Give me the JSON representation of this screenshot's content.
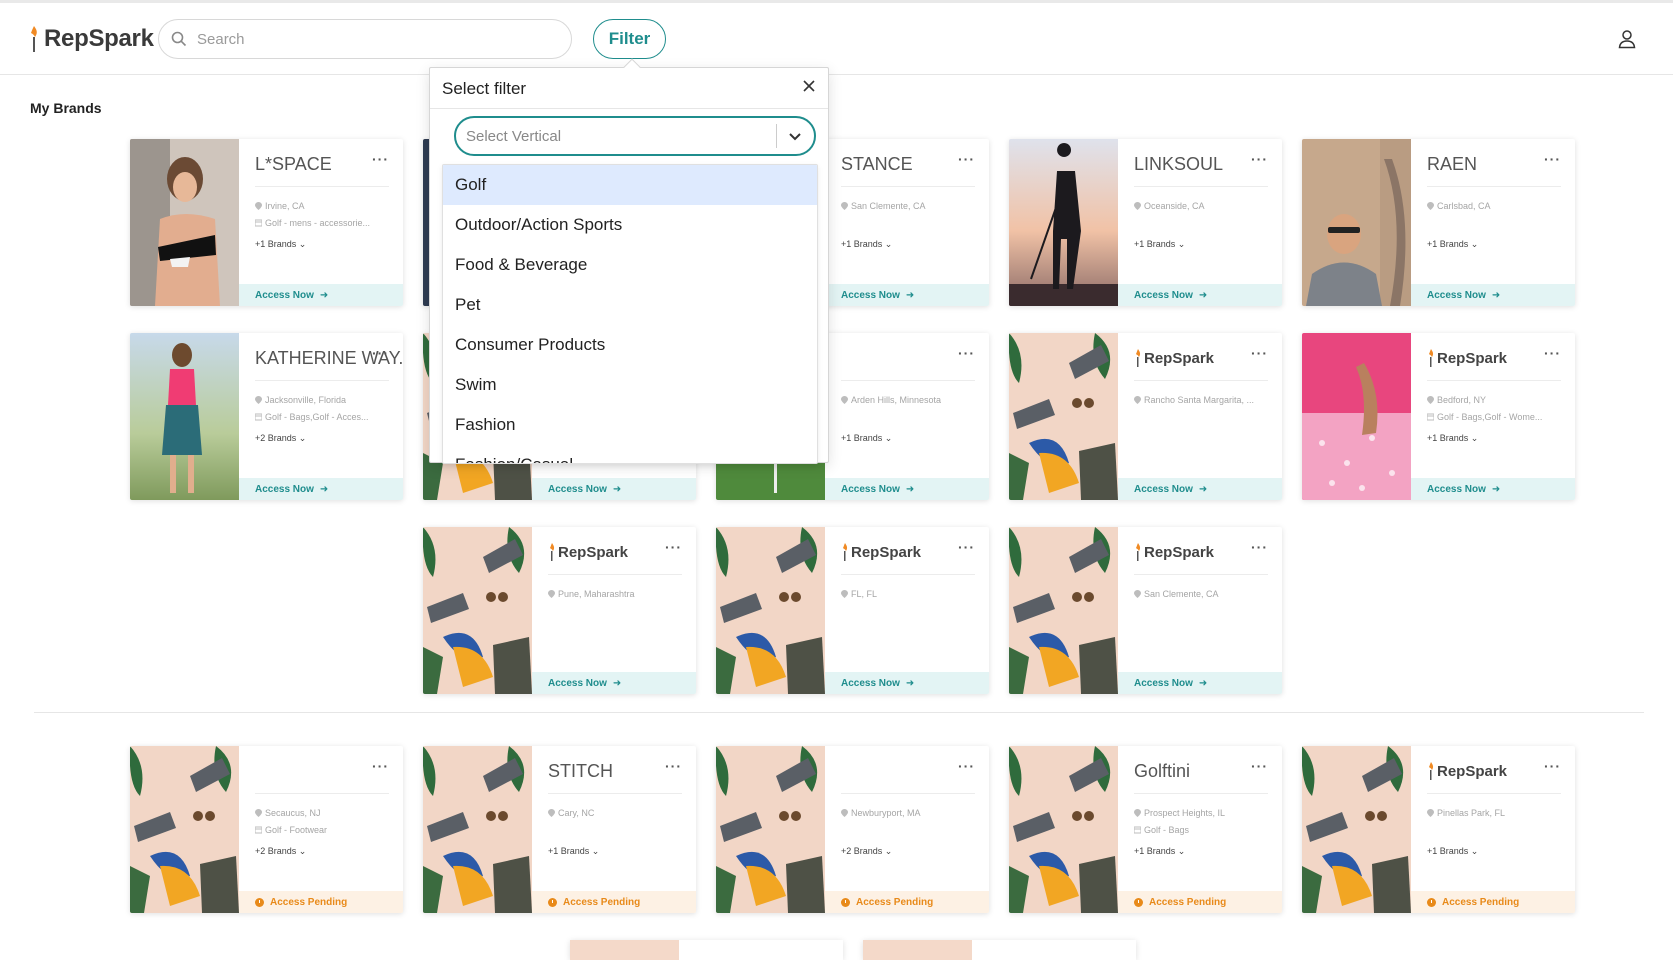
{
  "header": {
    "logo_text": "RepSpark",
    "search_placeholder": "Search",
    "filter_label": "Filter"
  },
  "section_title": "My Brands",
  "cards": [
    {
      "logo": "L*SPACE",
      "location": "Irvine, CA",
      "category": "Golf - mens - accessorie...",
      "brands": "+1 Brands",
      "status": "Access Now"
    },
    {
      "logo": "",
      "location": "",
      "category": "",
      "brands": "",
      "status": ""
    },
    {
      "logo": "STANCE",
      "location": "San Clemente, CA",
      "category": "",
      "brands": "+1 Brands",
      "status": "Access Now"
    },
    {
      "logo": "LINKSOUL",
      "location": "Oceanside, CA",
      "category": "",
      "brands": "+1 Brands",
      "status": "Access Now"
    },
    {
      "logo": "RAEN",
      "location": "Carlsbad, CA",
      "category": "",
      "brands": "+1 Brands",
      "status": "Access Now"
    },
    {
      "logo": "KATHERINE WAY.",
      "location": "Jacksonville, Florida",
      "category": "Golf - Bags,Golf - Acces...",
      "brands": "+2 Brands",
      "status": "Access Now"
    },
    {
      "logo": "",
      "location": "",
      "category": "",
      "brands": "",
      "status": "Access Now"
    },
    {
      "logo": "",
      "location": "Arden Hills, Minnesota",
      "category": "",
      "brands": "+1 Brands",
      "status": "Access Now"
    },
    {
      "logo": "RepSpark",
      "location": "Rancho Santa Margarita, ...",
      "category": "",
      "brands": "",
      "status": "Access Now"
    },
    {
      "logo": "RepSpark",
      "location": "Bedford, NY",
      "category": "Golf - Bags,Golf - Wome...",
      "brands": "+1 Brands",
      "status": "Access Now"
    },
    {
      "logo": "RepSpark",
      "location": "Pune, Maharashtra",
      "category": "",
      "brands": "",
      "status": "Access Now"
    },
    {
      "logo": "RepSpark",
      "location": "FL, FL",
      "category": "",
      "brands": "",
      "status": "Access Now"
    },
    {
      "logo": "RepSpark",
      "location": "San Clemente, CA",
      "category": "",
      "brands": "",
      "status": "Access Now"
    },
    {
      "logo": "",
      "location": "Secaucus, NJ",
      "category": "Golf - Footwear",
      "brands": "+2 Brands",
      "status": "Access Pending"
    },
    {
      "logo": "STITCH",
      "location": "Cary, NC",
      "category": "",
      "brands": "+1 Brands",
      "status": "Access Pending"
    },
    {
      "logo": "",
      "location": "Newburyport, MA",
      "category": "",
      "brands": "+2 Brands",
      "status": "Access Pending"
    },
    {
      "logo": "Golftini",
      "location": "Prospect Heights, IL",
      "category": "Golf - Bags",
      "brands": "+1 Brands",
      "status": "Access Pending"
    },
    {
      "logo": "RepSpark",
      "location": "Pinellas Park, FL",
      "category": "",
      "brands": "+1 Brands",
      "status": "Access Pending"
    }
  ],
  "filter_popover": {
    "title": "Select filter",
    "select_placeholder": "Select Vertical",
    "options": [
      "Golf",
      "Outdoor/Action Sports",
      "Food & Beverage",
      "Pet",
      "Consumer Products",
      "Swim",
      "Fashion",
      "Fashion/Casual"
    ],
    "highlighted": "Golf"
  },
  "colors": {
    "accent": "#1f8d8d",
    "pending": "#e88a1a",
    "option_highlight": "#deeafe"
  }
}
